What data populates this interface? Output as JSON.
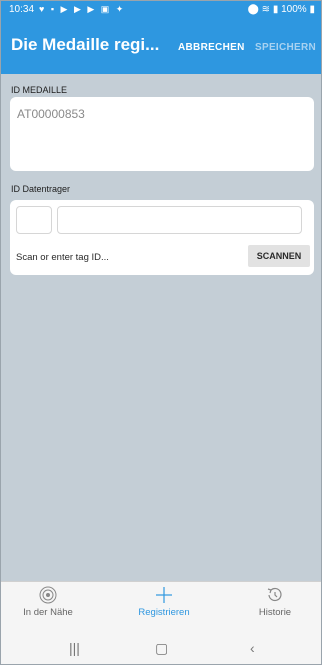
{
  "status": {
    "time": "10:34",
    "battery": "100%"
  },
  "appbar": {
    "title": "Die Medaille regi...",
    "cancel_label": "ABBRECHEN",
    "save_label": "SPEICHERN"
  },
  "medal_section": {
    "label": "ID MEDAILLE",
    "value": "AT00000853"
  },
  "carrier_section": {
    "label": "ID Datentrager",
    "scan_hint": "Scan or enter tag ID...",
    "scan_button": "SCANNEN"
  },
  "bottom_nav": [
    {
      "label": "In der Nähe",
      "icon": "radar-icon",
      "active": false
    },
    {
      "label": "Registrieren",
      "icon": "plus-icon",
      "active": true
    },
    {
      "label": "Historie",
      "icon": "history-icon",
      "active": false
    }
  ],
  "colors": {
    "accent": "#2e97e0",
    "background": "#c4ced6"
  }
}
